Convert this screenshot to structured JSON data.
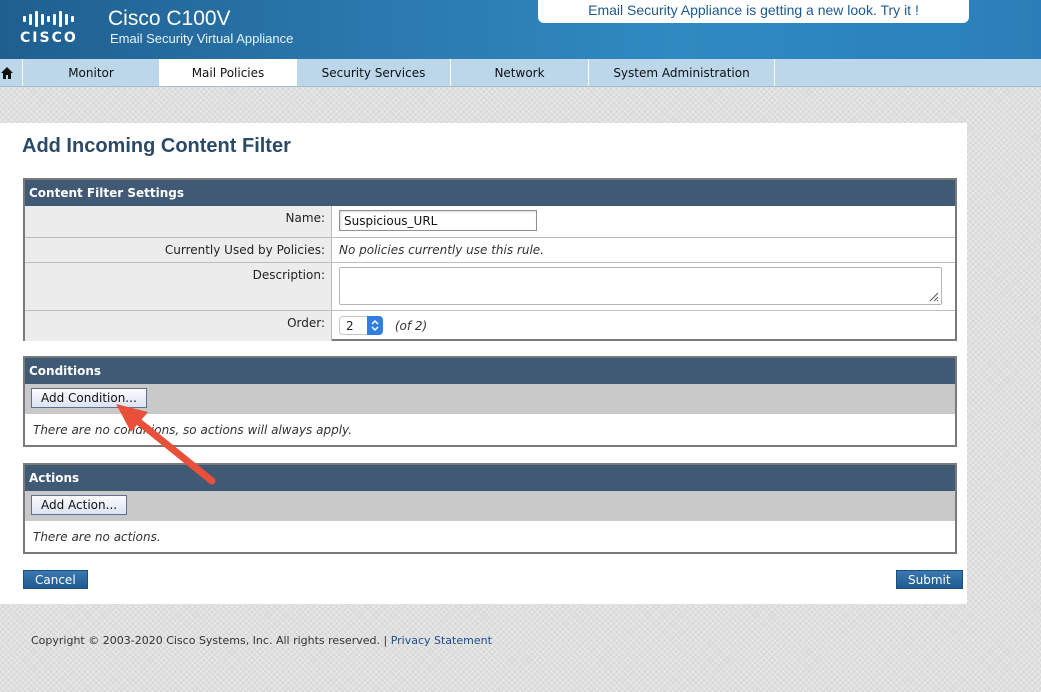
{
  "header": {
    "brand": "CISCO",
    "product_name": "Cisco C100V",
    "product_subtitle": "Email Security Virtual Appliance",
    "banner": "Email Security Appliance is getting a new look. Try it !"
  },
  "nav": {
    "home_icon": "home-icon",
    "tabs": [
      {
        "label": "Monitor"
      },
      {
        "label": "Mail Policies",
        "active": true
      },
      {
        "label": "Security Services"
      },
      {
        "label": "Network"
      },
      {
        "label": "System Administration"
      }
    ]
  },
  "page": {
    "title": "Add Incoming Content Filter"
  },
  "settings": {
    "heading": "Content Filter Settings",
    "name_label": "Name:",
    "name_value": "Suspicious_URL",
    "used_by_label": "Currently Used by Policies:",
    "used_by_value": "No policies currently use this rule.",
    "description_label": "Description:",
    "description_value": "",
    "order_label": "Order:",
    "order_value": "2",
    "order_total": "(of 2)"
  },
  "conditions": {
    "heading": "Conditions",
    "add_button": "Add Condition...",
    "empty_text": "There are no conditions, so actions will always apply."
  },
  "actions": {
    "heading": "Actions",
    "add_button": "Add Action...",
    "empty_text": "There are no actions."
  },
  "buttons": {
    "cancel": "Cancel",
    "submit": "Submit"
  },
  "footer": {
    "copyright": "Copyright © 2003-2020 Cisco Systems, Inc. All rights reserved. |",
    "privacy_link": "Privacy Statement"
  },
  "colors": {
    "header_blue": "#2a78ad",
    "nav_bg": "#bcd7ea",
    "section_header": "#405a76",
    "title_color": "#2c4a66",
    "annotation_arrow": "#e8503a"
  }
}
